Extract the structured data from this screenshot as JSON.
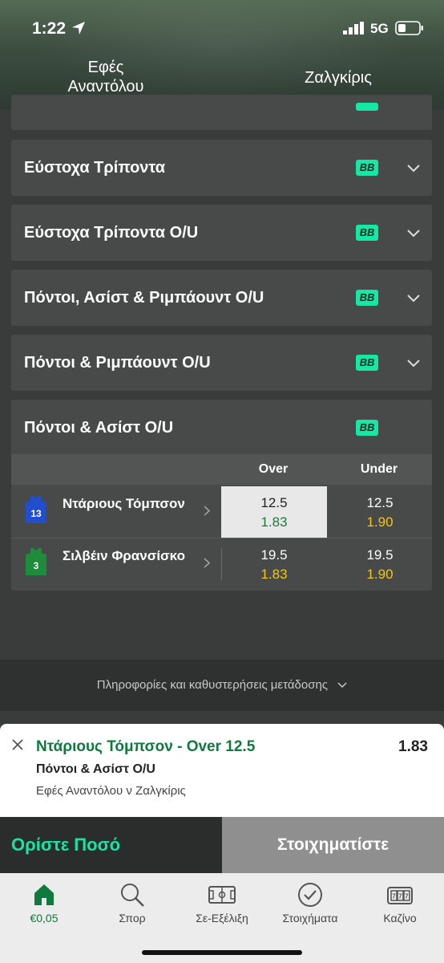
{
  "status_bar": {
    "time": "1:22",
    "network": "5G"
  },
  "match": {
    "home": "Εφές Αναντόλου",
    "away": "Ζαλγκίρις"
  },
  "markets": [
    {
      "title": "Εύστοχα Τρίποντα",
      "badge": "BB"
    },
    {
      "title": "Εύστοχα Τρίποντα O/U",
      "badge": "BB"
    },
    {
      "title": "Πόντοι, Ασίστ & Ριμπάουντ O/U",
      "badge": "BB"
    },
    {
      "title": "Πόντοι & Ριμπάουντ O/U",
      "badge": "BB"
    }
  ],
  "expanded_market": {
    "title": "Πόντοι & Ασίστ O/U",
    "badge": "BB",
    "col_over": "Over",
    "col_under": "Under",
    "rows": [
      {
        "name": "Ντάριους Τόμπσον",
        "number": "13",
        "jersey_color": "#1f4fcf",
        "over_line": "12.5",
        "over_odds": "1.83",
        "under_line": "12.5",
        "under_odds": "1.90",
        "selected": "over"
      },
      {
        "name": "Σιλβέιν Φρανσίσκο",
        "number": "3",
        "jersey_color": "#1e8c3a",
        "over_line": "19.5",
        "over_odds": "1.83",
        "under_line": "19.5",
        "under_odds": "1.90",
        "selected": "none"
      }
    ]
  },
  "info_bar": {
    "text": "Πληροφορίες και καθυστερήσεις μετάδοσης"
  },
  "bet_slip": {
    "selection": "Ντάριους Τόμπσον - Over 12.5",
    "market": "Πόντοι & Ασίστ O/U",
    "event": "Εφές Αναντόλου ν Ζαλγκίρις",
    "odds": "1.83"
  },
  "actions": {
    "set_stake": "Ορίστε Ποσό",
    "place_bet": "Στοιχηματίστε"
  },
  "tabs": [
    {
      "label": "€0,05",
      "icon": "home-icon",
      "active": true
    },
    {
      "label": "Σπορ",
      "icon": "search-icon",
      "active": false
    },
    {
      "label": "Σε-Εξέλιξη",
      "icon": "pitch-icon",
      "active": false
    },
    {
      "label": "Στοιχήματα",
      "icon": "check-icon",
      "active": false
    },
    {
      "label": "Καζίνο",
      "icon": "slot-icon",
      "active": false
    }
  ],
  "colors": {
    "accent": "#16e3a4",
    "odds_yellow": "#f5c518",
    "brand_green": "#0e7a3e"
  }
}
